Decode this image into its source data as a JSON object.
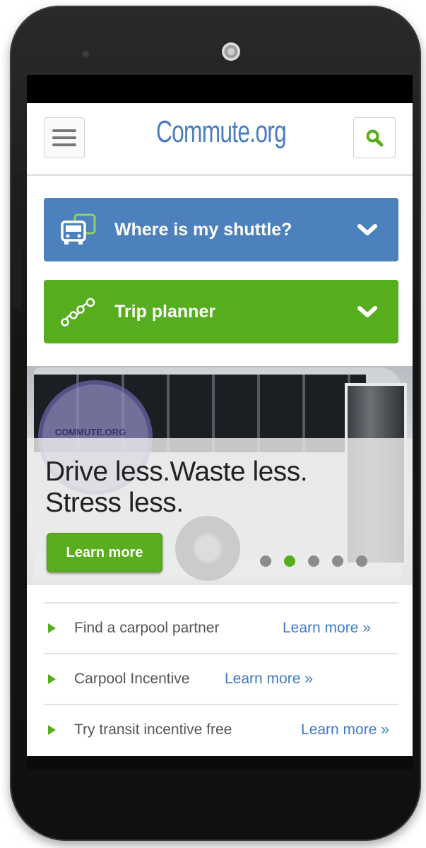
{
  "header": {
    "logo_main": "Commute",
    "logo_suffix": ".org"
  },
  "shuttle_bar": {
    "label": "Where is my shuttle?",
    "icon": "shuttle-bus-icon"
  },
  "trip_bar": {
    "label": "Trip planner",
    "icon": "route-dots-icon"
  },
  "hero": {
    "line1": "Drive less.Waste less.",
    "line2": "Stress less.",
    "button_label": "Learn more",
    "seal_text": "COMMUTE.ORG",
    "slides_total": 5,
    "active_slide": 2
  },
  "links": [
    {
      "text": "Find a carpool partner",
      "more": "Learn more »"
    },
    {
      "text": "Carpool Incentive",
      "more": "Learn more »"
    },
    {
      "text": "Try transit incentive free",
      "more": "Learn more »"
    }
  ],
  "colors": {
    "brand_blue": "#4d81bd",
    "brand_green": "#56ad1d",
    "link_blue": "#3f7bc4"
  }
}
